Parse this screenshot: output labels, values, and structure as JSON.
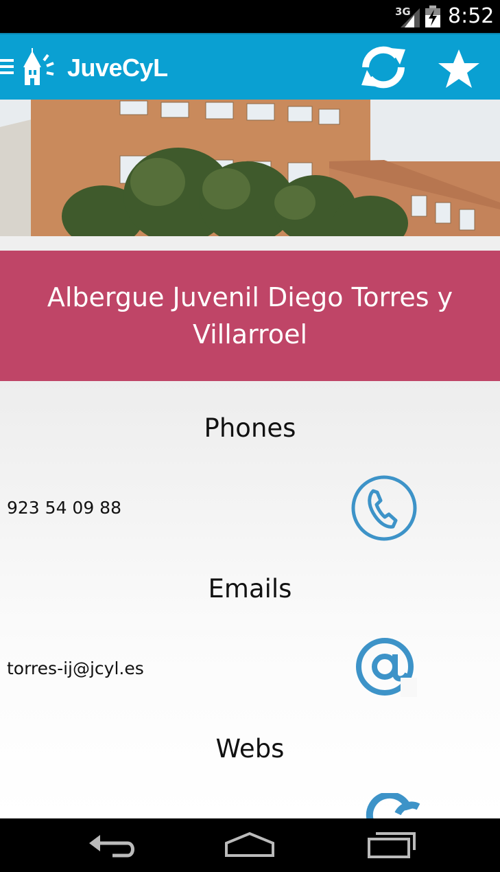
{
  "status_bar": {
    "network": "3G",
    "time": "8:52"
  },
  "app_bar": {
    "title": "JuveCyL"
  },
  "place": {
    "name": "Albergue Juvenil Diego Torres y Villarroel"
  },
  "sections": {
    "phones": {
      "title": "Phones",
      "value": "923 54 09 88"
    },
    "emails": {
      "title": "Emails",
      "value": "torres-ij@jcyl.es"
    },
    "webs": {
      "title": "Webs"
    }
  },
  "colors": {
    "app_bar": "#0aa0d2",
    "title_band": "#bf4567",
    "icon_blue": "#3d93c8"
  }
}
